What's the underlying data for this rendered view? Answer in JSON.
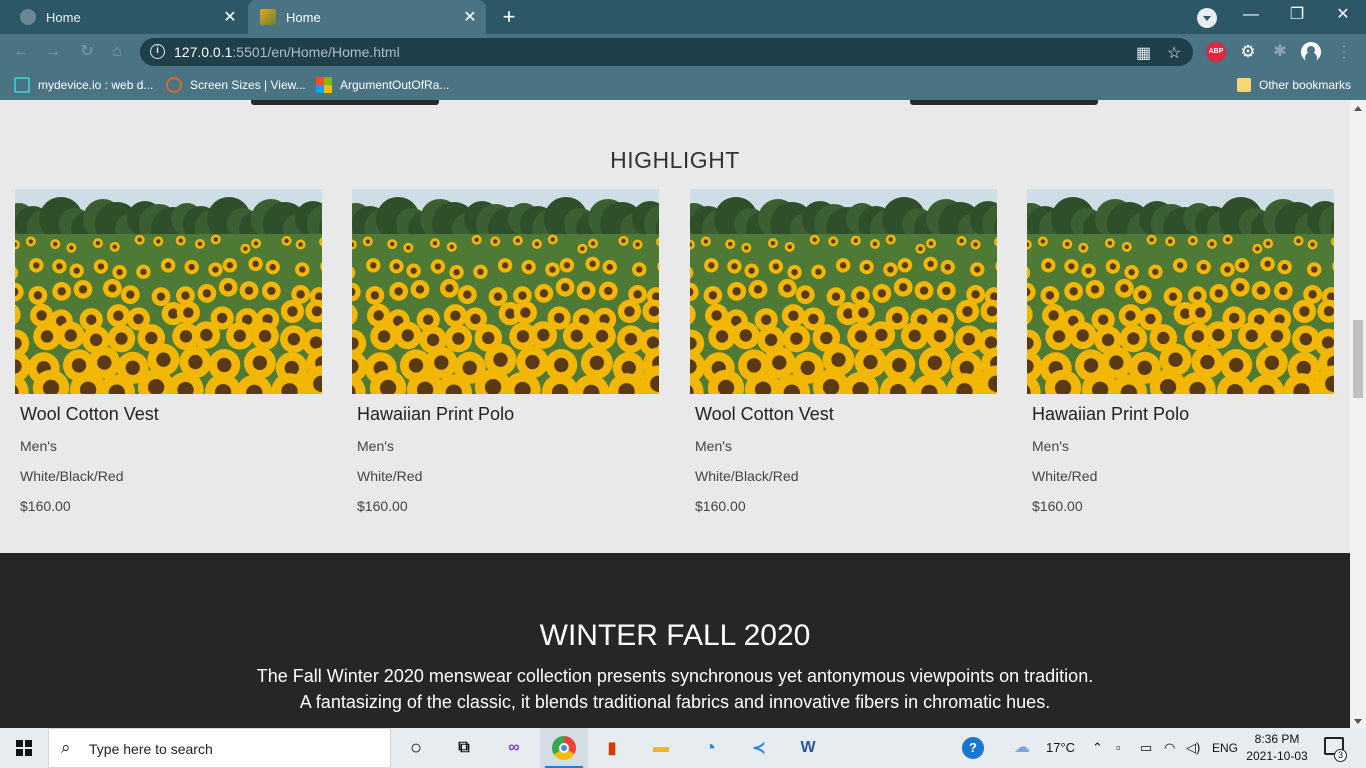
{
  "browser": {
    "tabs": [
      {
        "title": "Home",
        "active": false
      },
      {
        "title": "Home",
        "active": true
      }
    ],
    "url_host": "127.0.0.1",
    "url_rest": ":5501/en/Home/Home.html",
    "bookmarks": [
      {
        "label": "mydevice.io : web d...",
        "icon": "mydevice-icon"
      },
      {
        "label": "Screen Sizes | View...",
        "icon": "screensizes-icon"
      },
      {
        "label": "ArgumentOutOfRa...",
        "icon": "microsoft-icon"
      }
    ],
    "other_bookmarks": "Other bookmarks",
    "abp_label": "ABP"
  },
  "highlight": {
    "title": "HIGHLIGHT",
    "products": [
      {
        "name": "Wool Cotton Vest",
        "category": "Men's",
        "colors": "White/Black/Red",
        "price": "$160.00"
      },
      {
        "name": "Hawaiian Print Polo",
        "category": "Men's",
        "colors": "White/Red",
        "price": "$160.00"
      },
      {
        "name": "Wool Cotton Vest",
        "category": "Men's",
        "colors": "White/Black/Red",
        "price": "$160.00"
      },
      {
        "name": "Hawaiian Print Polo",
        "category": "Men's",
        "colors": "White/Red",
        "price": "$160.00"
      }
    ]
  },
  "collection": {
    "title": "WINTER FALL 2020",
    "line1": "The Fall Winter 2020 menswear collection presents synchronous yet antonymous viewpoints on tradition.",
    "line2": "A fantasizing of the classic, it blends traditional fabrics and innovative fibers in chromatic hues."
  },
  "taskbar": {
    "search_placeholder": "Type here to search",
    "weather": "17°C",
    "language": "ENG",
    "time": "8:36 PM",
    "date": "2021-10-03",
    "notification_count": "3"
  },
  "colors": {
    "chrome_tab_bar": "#2c5767",
    "chrome_toolbar": "#4a7484",
    "page_bg": "#e9e9e9",
    "dark_section": "#262626"
  }
}
